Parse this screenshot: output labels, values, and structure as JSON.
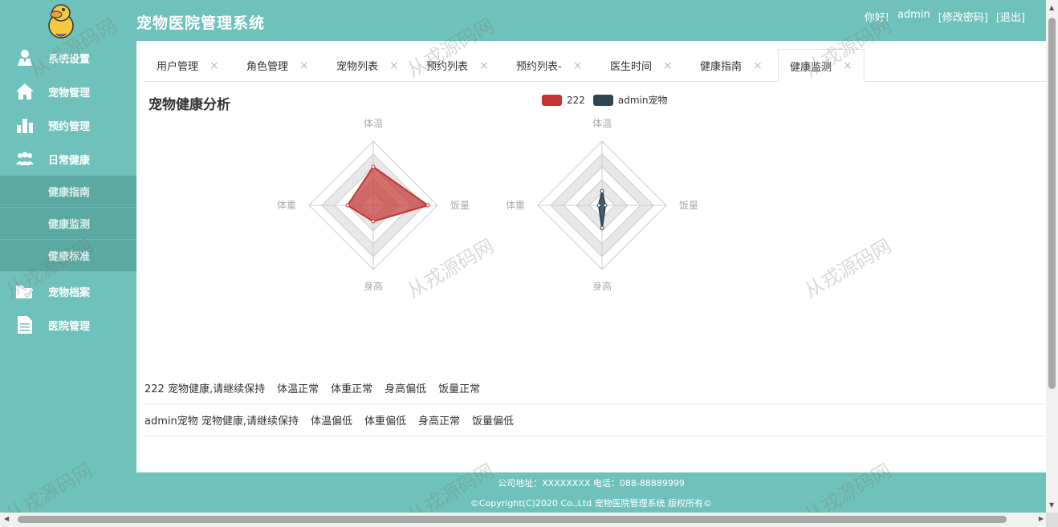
{
  "app": {
    "title": "宠物医院管理系统",
    "greeting": "你好!",
    "username": "admin",
    "change_password": "[修改密码]",
    "logout": "[退出]"
  },
  "sidebar": {
    "items": [
      {
        "label": "系统设置",
        "icon": "user-settings-icon"
      },
      {
        "label": "宠物管理",
        "icon": "home-icon"
      },
      {
        "label": "预约管理",
        "icon": "bar-chart-icon"
      },
      {
        "label": "日常健康",
        "icon": "group-icon"
      }
    ],
    "sub_items": [
      {
        "label": "健康指南"
      },
      {
        "label": "健康监测"
      },
      {
        "label": "健康标准"
      }
    ],
    "items_after": [
      {
        "label": "宠物档案",
        "icon": "check-folder-icon"
      },
      {
        "label": "医院管理",
        "icon": "document-icon"
      }
    ]
  },
  "tabs": [
    {
      "label": "用户管理"
    },
    {
      "label": "角色管理"
    },
    {
      "label": "宠物列表"
    },
    {
      "label": "预约列表"
    },
    {
      "label": "预约列表-"
    },
    {
      "label": "医生时间"
    },
    {
      "label": "健康指南"
    },
    {
      "label": "健康监测",
      "active": true
    }
  ],
  "close_glyph": "×",
  "section_title": "宠物健康分析",
  "chart_data": [
    {
      "type": "radar",
      "indicators": [
        "体温",
        "饭量",
        "身高",
        "体重"
      ],
      "series": [
        {
          "name": "222",
          "color": "#c23531",
          "values": [
            0.6,
            0.85,
            0.25,
            0.4
          ]
        }
      ]
    },
    {
      "type": "radar",
      "indicators": [
        "体温",
        "饭量",
        "身高",
        "体重"
      ],
      "series": [
        {
          "name": "admin宠物",
          "color": "#2f4554",
          "values": [
            0.22,
            0.05,
            0.35,
            0.05
          ]
        }
      ]
    }
  ],
  "legend": [
    {
      "name": "222",
      "color": "#c23531"
    },
    {
      "name": "admin宠物",
      "color": "#2f4554"
    }
  ],
  "results": [
    {
      "text": "222 宠物健康,请继续保持",
      "items": [
        "体温正常",
        "体重正常",
        "身高偏低",
        "饭量正常"
      ]
    },
    {
      "text": "admin宠物 宠物健康,请继续保持",
      "items": [
        "体温偏低",
        "体重偏低",
        "身高正常",
        "饭量偏低"
      ]
    }
  ],
  "footer": {
    "address": "公司地址：XXXXXXXX 电话：088-88889999",
    "copyright": "©Copyright(C)2020 Co.,Ltd 宠物医院管理系统 版权所有©"
  },
  "watermark": "从戎源码网"
}
